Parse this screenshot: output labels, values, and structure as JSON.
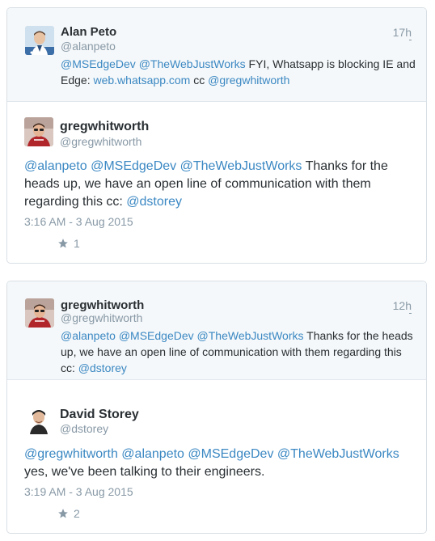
{
  "thread1": {
    "parent": {
      "name": "Alan Peto",
      "handle": "@alanpeto",
      "time": "17h",
      "text_parts": [
        {
          "t": "@MSEdgeDev",
          "link": true
        },
        {
          "t": " ",
          "link": false
        },
        {
          "t": "@TheWebJustWorks",
          "link": true
        },
        {
          "t": " FYI, Whatsapp is blocking IE and Edge:  ",
          "link": false
        },
        {
          "t": "web.whatsapp.com",
          "link": true
        },
        {
          "t": "  cc ",
          "link": false
        },
        {
          "t": "@gregwhitworth",
          "link": true
        }
      ]
    },
    "reply": {
      "name": "gregwhitworth",
      "handle": "@gregwhitworth",
      "text_parts": [
        {
          "t": "@alanpeto",
          "link": true
        },
        {
          "t": " ",
          "link": false
        },
        {
          "t": "@MSEdgeDev",
          "link": true
        },
        {
          "t": " ",
          "link": false
        },
        {
          "t": "@TheWebJustWorks",
          "link": true
        },
        {
          "t": " Thanks for the heads up, we have an open line of communication with them regarding this cc: ",
          "link": false
        },
        {
          "t": "@dstorey",
          "link": true
        }
      ],
      "timestamp": "3:16 AM - 3 Aug 2015",
      "favorites": "1"
    }
  },
  "thread2": {
    "parent": {
      "name": "gregwhitworth",
      "handle": "@gregwhitworth",
      "time": "12h",
      "text_parts": [
        {
          "t": "@alanpeto",
          "link": true
        },
        {
          "t": " ",
          "link": false
        },
        {
          "t": "@MSEdgeDev",
          "link": true
        },
        {
          "t": " ",
          "link": false
        },
        {
          "t": "@TheWebJustWorks",
          "link": true
        },
        {
          "t": " Thanks for the heads up, we have an open line of communication with them regarding this cc: ",
          "link": false
        },
        {
          "t": "@dstorey",
          "link": true
        }
      ]
    },
    "reply": {
      "name": "David Storey",
      "handle": "@dstorey",
      "text_parts": [
        {
          "t": "@gregwhitworth",
          "link": true
        },
        {
          "t": " ",
          "link": false
        },
        {
          "t": "@alanpeto",
          "link": true
        },
        {
          "t": " ",
          "link": false
        },
        {
          "t": "@MSEdgeDev",
          "link": true
        },
        {
          "t": " ",
          "link": false
        },
        {
          "t": "@TheWebJustWorks",
          "link": true
        },
        {
          "t": " yes, we've been talking to their engineers.",
          "link": false
        }
      ],
      "timestamp": "3:19 AM - 3 Aug 2015",
      "favorites": "2"
    }
  },
  "colors": {
    "link": "#3b88c3",
    "muted": "#8899a6",
    "text": "#292f33",
    "parent_bg": "#f5f8fa"
  },
  "icons": [
    "star-icon"
  ]
}
